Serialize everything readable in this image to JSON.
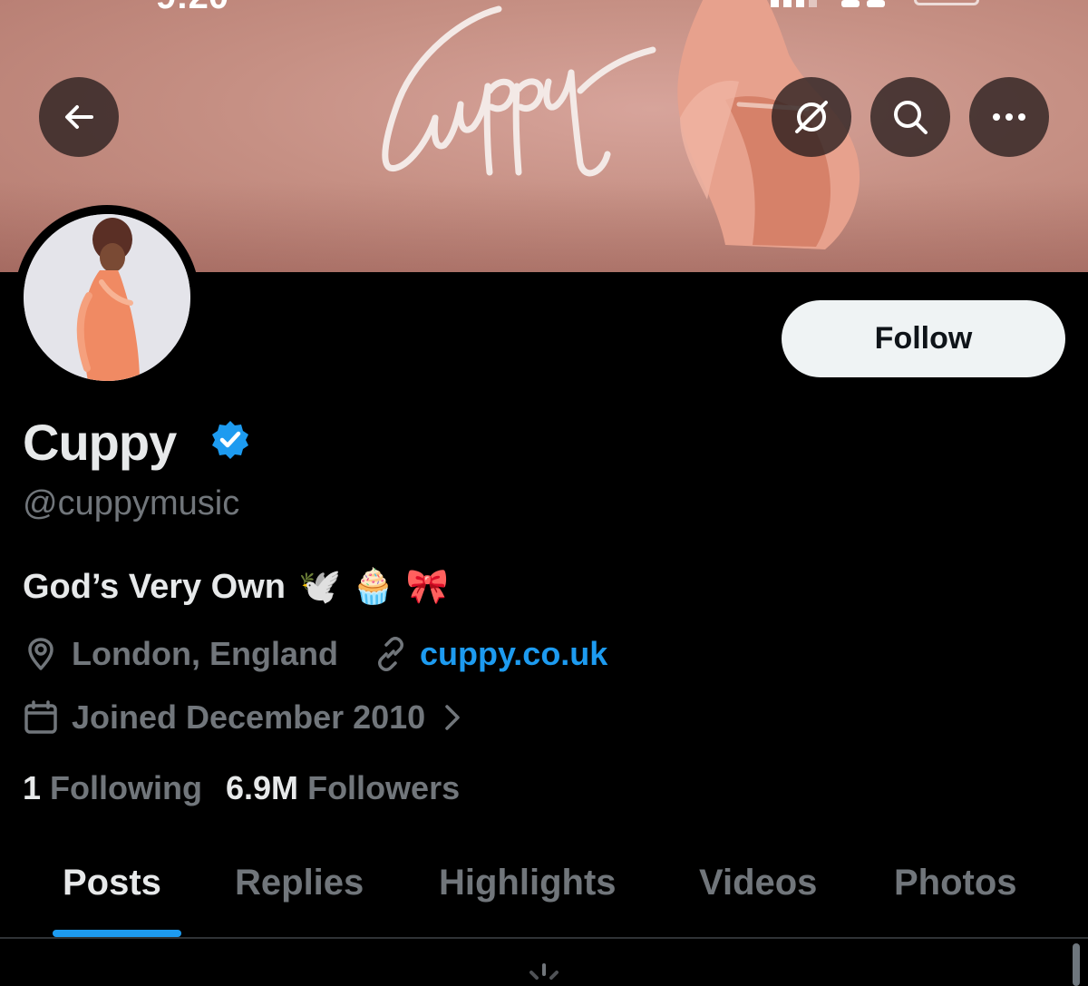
{
  "profile": {
    "display_name": "Cuppy",
    "handle": "@cuppymusic",
    "bio": "God’s Very Own",
    "bio_emojis": "🕊️ 🧁 🎀",
    "location": "London, England",
    "website": "cuppy.co.uk",
    "joined": "Joined December 2010",
    "following_count": "1",
    "following_label": "Following",
    "followers_count": "6.9M",
    "followers_label": "Followers"
  },
  "actions": {
    "follow_label": "Follow"
  },
  "tabs": [
    {
      "label": "Posts",
      "active": true
    },
    {
      "label": "Replies",
      "active": false
    },
    {
      "label": "Highlights",
      "active": false
    },
    {
      "label": "Videos",
      "active": false
    },
    {
      "label": "Photos",
      "active": false
    }
  ],
  "icons": {
    "back": "arrow-left-icon",
    "grok": "grok-icon",
    "search": "search-icon",
    "more": "more-horizontal-icon",
    "verified": "verified-badge-icon",
    "location": "location-pin-icon",
    "link": "link-icon",
    "calendar": "calendar-icon",
    "chevron": "chevron-right-icon"
  },
  "colors": {
    "background": "#000000",
    "accent": "#1d9bf0",
    "secondary_text": "#71767b",
    "primary_text": "#e7e9ea",
    "follow_button_bg": "#eff3f4"
  }
}
